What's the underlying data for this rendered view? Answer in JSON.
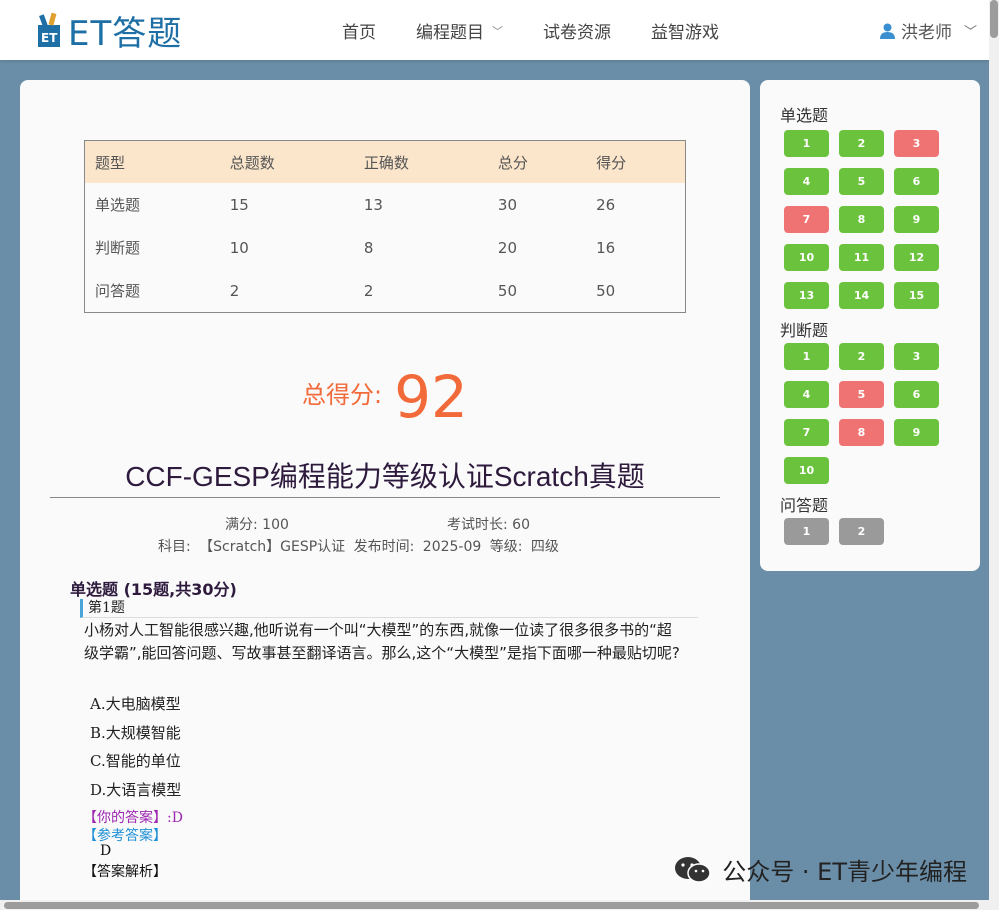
{
  "header": {
    "logo_text": "ET答题",
    "nav": [
      "首页",
      "编程题目",
      "试卷资源",
      "益智游戏"
    ],
    "user_name": "洪老师"
  },
  "summary": {
    "headers": [
      "题型",
      "总题数",
      "正确数",
      "总分",
      "得分"
    ],
    "rows": [
      [
        "单选题",
        "15",
        "13",
        "30",
        "26"
      ],
      [
        "判断题",
        "10",
        "8",
        "20",
        "16"
      ],
      [
        "问答题",
        "2",
        "2",
        "50",
        "50"
      ]
    ]
  },
  "score": {
    "label": "总得分:",
    "value": "92"
  },
  "exam": {
    "title": "CCF-GESP编程能力等级认证Scratch真题",
    "full_marks": "满分: 100",
    "duration": "考试时长: 60",
    "info": "科目: 【Scratch】GESP认证 发布时间: 2025-09 等级: 四级"
  },
  "section": {
    "title": "单选题 (15题,共30分)"
  },
  "question": {
    "head": "第1题",
    "text": "小杨对人工智能很感兴趣,他听说有一个叫“大模型”的东西,就像一位读了很多很多书的“超级学霸”,能回答问题、写故事甚至翻译语言。那么,这个“大模型”是指下面哪一种最贴切呢?",
    "options": [
      "A.大电脑模型",
      "B.大规模智能",
      "C.智能的单位",
      "D.大语言模型"
    ],
    "your_answer": "【你的答案】:D",
    "ref_label": "【参考答案】",
    "ref_value": "D",
    "analysis_label": "【答案解析】"
  },
  "sidebar": {
    "single_title": "单选题",
    "single": [
      {
        "n": "1",
        "s": "correct"
      },
      {
        "n": "2",
        "s": "correct"
      },
      {
        "n": "3",
        "s": "wrong"
      },
      {
        "n": "4",
        "s": "correct"
      },
      {
        "n": "5",
        "s": "correct"
      },
      {
        "n": "6",
        "s": "correct"
      },
      {
        "n": "7",
        "s": "wrong"
      },
      {
        "n": "8",
        "s": "correct"
      },
      {
        "n": "9",
        "s": "correct"
      },
      {
        "n": "10",
        "s": "correct"
      },
      {
        "n": "11",
        "s": "correct"
      },
      {
        "n": "12",
        "s": "correct"
      },
      {
        "n": "13",
        "s": "correct"
      },
      {
        "n": "14",
        "s": "correct"
      },
      {
        "n": "15",
        "s": "correct"
      }
    ],
    "judge_title": "判断题",
    "judge": [
      {
        "n": "1",
        "s": "correct"
      },
      {
        "n": "2",
        "s": "correct"
      },
      {
        "n": "3",
        "s": "correct"
      },
      {
        "n": "4",
        "s": "correct"
      },
      {
        "n": "5",
        "s": "wrong"
      },
      {
        "n": "6",
        "s": "correct"
      },
      {
        "n": "7",
        "s": "correct"
      },
      {
        "n": "8",
        "s": "wrong"
      },
      {
        "n": "9",
        "s": "correct"
      },
      {
        "n": "10",
        "s": "correct"
      }
    ],
    "qa_title": "问答题",
    "qa": [
      {
        "n": "1",
        "s": "neutral"
      },
      {
        "n": "2",
        "s": "neutral"
      }
    ]
  },
  "colors": {
    "correct": "#6bc33d",
    "wrong": "#f07373",
    "neutral": "#9a9a9a",
    "score": "#f26a3a"
  },
  "watermark": "公众号 · ET青少年编程"
}
